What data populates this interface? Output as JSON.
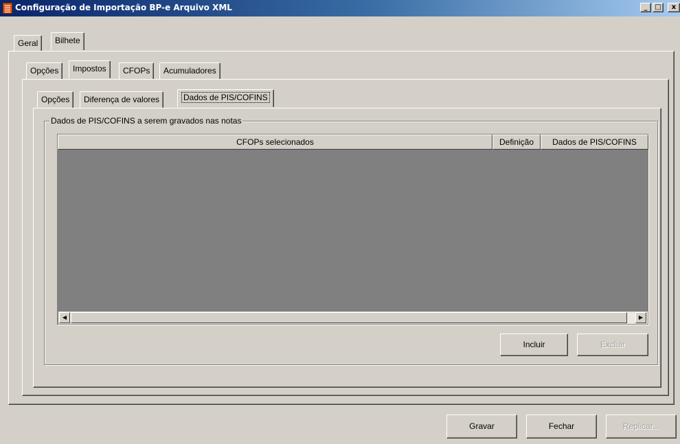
{
  "window": {
    "title": "Configuração de Importação BP-e Arquivo XML",
    "minimize_glyph": "_",
    "maximize_glyph": "□",
    "close_glyph": "x"
  },
  "tabs_level1": [
    {
      "label": "Geral",
      "active": false
    },
    {
      "label": "Bilhete",
      "active": true
    }
  ],
  "tabs_level2": [
    {
      "label": "Opções",
      "active": false
    },
    {
      "label": "Impostos",
      "active": true
    },
    {
      "label": "CFOPs",
      "active": false
    },
    {
      "label": "Acumuladores",
      "active": false
    }
  ],
  "tabs_level3": [
    {
      "label": "Opções",
      "active": false
    },
    {
      "label": "Diferença de valores",
      "active": false
    },
    {
      "label": "Dados de PIS/COFINS",
      "active": true
    }
  ],
  "group": {
    "label": "Dados de PIS/COFINS a serem gravados nas notas"
  },
  "grid": {
    "columns": [
      "CFOPs selecionados",
      "Definição",
      "Dados de PIS/COFINS"
    ],
    "rows": []
  },
  "buttons": {
    "incluir": "Incluir",
    "excluir": "Excluir",
    "gravar": "Gravar",
    "fechar": "Fechar",
    "replicar": "Replicar..."
  },
  "colors": {
    "title_start": "#0a246a",
    "title_end": "#a6caf0",
    "face": "#d4d0c8",
    "icon": "#e05a1a"
  }
}
